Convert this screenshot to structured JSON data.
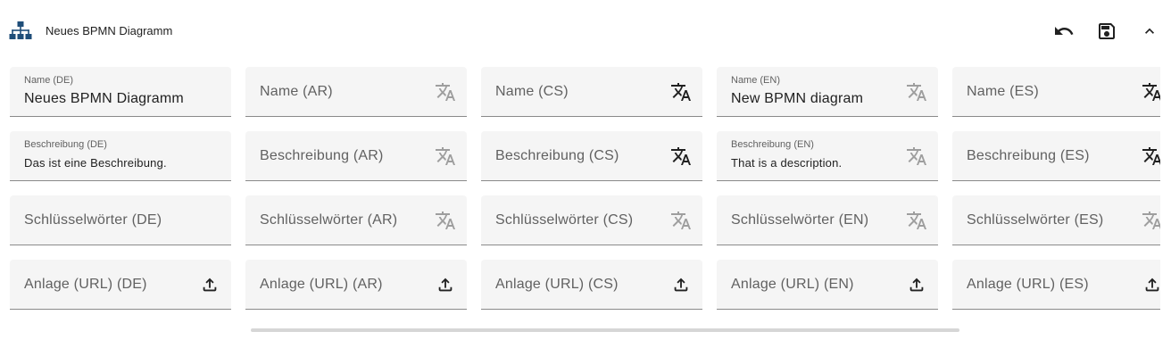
{
  "header": {
    "title": "Neues BPMN Diagramm",
    "icons": {
      "diagram": "sitemap-icon",
      "undo": "undo-icon",
      "save": "save-icon",
      "collapse": "chevron-up-icon"
    }
  },
  "colors": {
    "icon": "#1f4e79",
    "field_bg": "#f5f5f5",
    "translate_active": "#212121",
    "translate_muted": "#9e9e9e"
  },
  "fields": {
    "row1": [
      {
        "label": "Name (DE)",
        "value": "Neues BPMN Diagramm",
        "icon": "none"
      },
      {
        "label": "Name (AR)",
        "value": "",
        "icon": "translate-icon"
      },
      {
        "label": "Name (CS)",
        "value": "",
        "icon": "translate-icon"
      },
      {
        "label": "Name (EN)",
        "value": "New BPMN diagram",
        "icon": "translate-icon"
      },
      {
        "label": "Name (ES)",
        "value": "",
        "icon": "translate-icon"
      }
    ],
    "row2": [
      {
        "label": "Beschreibung (DE)",
        "value": "Das ist eine Beschreibung.",
        "icon": "none"
      },
      {
        "label": "Beschreibung (AR)",
        "value": "",
        "icon": "translate-icon"
      },
      {
        "label": "Beschreibung (CS)",
        "value": "",
        "icon": "translate-icon"
      },
      {
        "label": "Beschreibung (EN)",
        "value": "That is a description.",
        "icon": "translate-icon"
      },
      {
        "label": "Beschreibung (ES)",
        "value": "",
        "icon": "translate-icon"
      }
    ],
    "row3": [
      {
        "label": "Schlüsselwörter (DE)",
        "value": "",
        "icon": "none"
      },
      {
        "label": "Schlüsselwörter (AR)",
        "value": "",
        "icon": "translate-icon"
      },
      {
        "label": "Schlüsselwörter (CS)",
        "value": "",
        "icon": "translate-icon"
      },
      {
        "label": "Schlüsselwörter (EN)",
        "value": "",
        "icon": "translate-icon"
      },
      {
        "label": "Schlüsselwörter (ES)",
        "value": "",
        "icon": "translate-icon"
      }
    ],
    "row4": [
      {
        "label": "Anlage (URL) (DE)",
        "value": "",
        "icon": "upload-icon"
      },
      {
        "label": "Anlage (URL) (AR)",
        "value": "",
        "icon": "upload-icon"
      },
      {
        "label": "Anlage (URL) (CS)",
        "value": "",
        "icon": "upload-icon"
      },
      {
        "label": "Anlage (URL) (EN)",
        "value": "",
        "icon": "upload-icon"
      },
      {
        "label": "Anlage (URL) (ES)",
        "value": "",
        "icon": "upload-icon"
      }
    ]
  }
}
